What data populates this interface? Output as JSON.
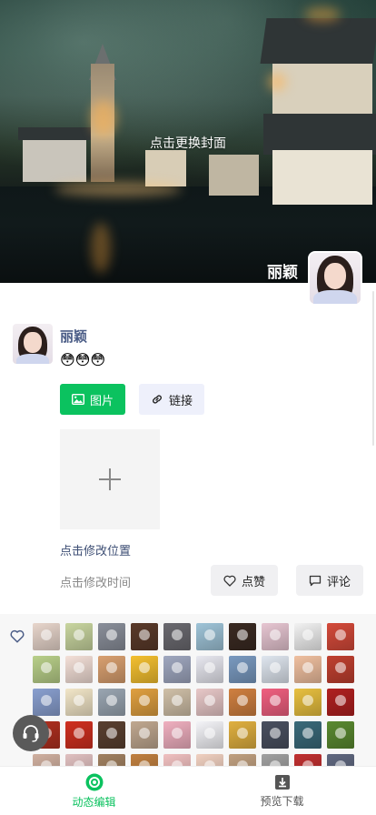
{
  "cover": {
    "change_label": "点击更换封面",
    "user_name": "丽颖"
  },
  "post": {
    "user_name": "丽颖",
    "text": "😳😳😳",
    "image_button": "图片",
    "link_button": "链接",
    "location": "点击修改位置",
    "time": "点击修改时间",
    "like_button": "点赞",
    "comment_button": "评论"
  },
  "likes": {
    "colors": [
      "#e8d6cc",
      "#c9d6a0",
      "#8a8f9a",
      "#5a3a2a",
      "#6b6a70",
      "#9fc4d8",
      "#3a2a22",
      "#e7c6d2",
      "#f2f2f2",
      "#d44a3a",
      "#b9d08a",
      "#f4e0d8",
      "#d9a070",
      "#f4c030",
      "#a0a8c0",
      "#e8e8f0",
      "#7a9ac0",
      "#dfe6ef",
      "#f0c0a0",
      "#c04030",
      "#8aa0d0",
      "#f2e6c8",
      "#9aa6b2",
      "#e0a040",
      "#d0c0a8",
      "#e8c8c8",
      "#d08040",
      "#f06080",
      "#e8c040",
      "#b02020",
      "#b03020",
      "#d03020",
      "#5a4030",
      "#c0a890",
      "#f0b0c0",
      "#f4f4f8",
      "#e0b040",
      "#4a5060",
      "#3a6a7a",
      "#5a8a30",
      "#d0b0a0",
      "#e0c0c0",
      "#a08060",
      "#c08040",
      "#f0c0c0",
      "#f0d0c0",
      "#c0a080",
      "#a0a0a0",
      "#c03030",
      "#606880"
    ]
  },
  "tabs": [
    {
      "label": "动态编辑",
      "active": true
    },
    {
      "label": "预览下载",
      "active": false
    }
  ]
}
